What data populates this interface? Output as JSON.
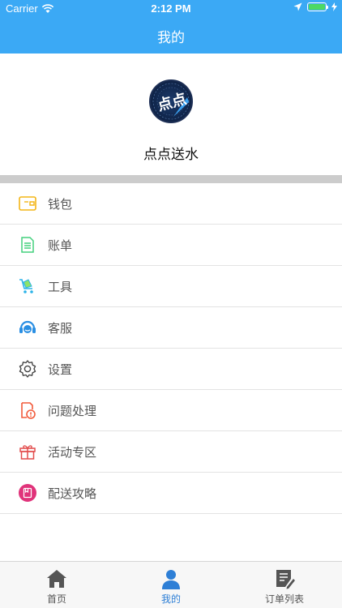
{
  "status_bar": {
    "carrier": "Carrier",
    "time": "2:12 PM",
    "battery_level": 1.0
  },
  "nav": {
    "title": "我的"
  },
  "profile": {
    "avatar_text": "点点",
    "name": "点点送水"
  },
  "menu": {
    "items": [
      {
        "label": "钱包",
        "icon": "wallet-icon",
        "color": "#f3b517"
      },
      {
        "label": "账单",
        "icon": "bill-icon",
        "color": "#43d17d"
      },
      {
        "label": "工具",
        "icon": "cart-tool-icon",
        "color": "#2ab3e8"
      },
      {
        "label": "客服",
        "icon": "customer-service-icon",
        "color": "#2a8fe3"
      },
      {
        "label": "设置",
        "icon": "gear-icon",
        "color": "#444444"
      },
      {
        "label": "问题处理",
        "icon": "issue-icon",
        "color": "#f25a3a"
      },
      {
        "label": "活动专区",
        "icon": "gift-icon",
        "color": "#e24c4c"
      },
      {
        "label": "配送攻略",
        "icon": "guide-icon",
        "color": "#e0337a"
      }
    ]
  },
  "tabs": [
    {
      "label": "首页",
      "icon": "home-icon",
      "active": false
    },
    {
      "label": "我的",
      "icon": "person-icon",
      "active": true
    },
    {
      "label": "订单列表",
      "icon": "order-list-icon",
      "active": false
    }
  ],
  "colors": {
    "primary": "#3ba9f5",
    "active_tab": "#2e7fd6"
  }
}
